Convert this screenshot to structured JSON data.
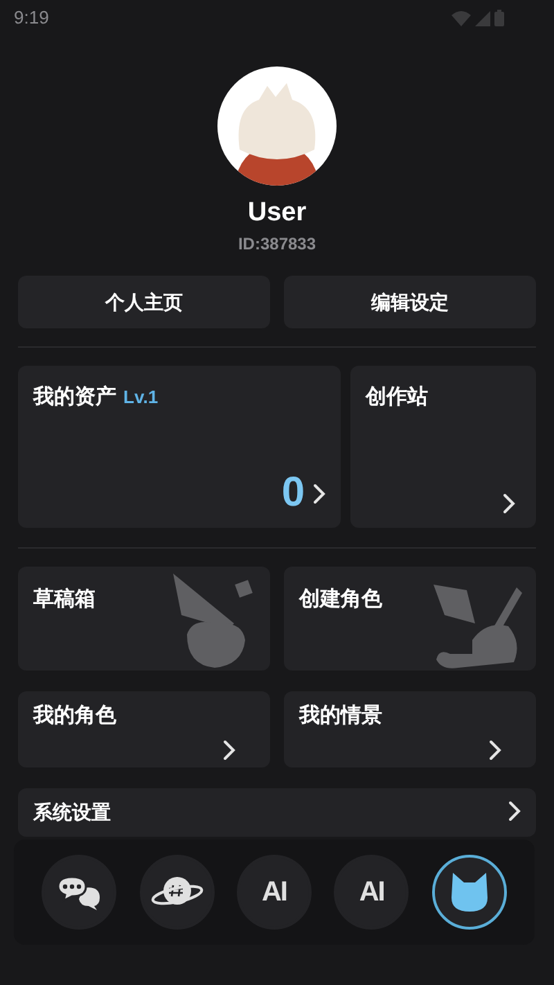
{
  "status_bar": {
    "time": "9:19"
  },
  "profile": {
    "name": "User",
    "id": "ID:387833"
  },
  "actions": [
    "个人主页",
    "编辑设定"
  ],
  "assets": {
    "title": "我的资产",
    "level": "Lv.1",
    "count": "0"
  },
  "studio": {
    "title": "创作站"
  },
  "feature_cards": [
    {
      "title": "草稿箱",
      "kind": "drafts"
    },
    {
      "title": "创建角色",
      "kind": "create"
    }
  ],
  "links": [
    "我的角色",
    "我的情景"
  ],
  "settings": {
    "title": "系统设置"
  },
  "bottom_nav": [
    {
      "kind": "chat",
      "selected": false
    },
    {
      "kind": "planet",
      "selected": false
    },
    {
      "kind": "ai_sparkle",
      "label": "AI",
      "selected": false
    },
    {
      "kind": "ai",
      "label": "AI",
      "selected": false
    },
    {
      "kind": "mascot",
      "selected": true
    }
  ]
}
